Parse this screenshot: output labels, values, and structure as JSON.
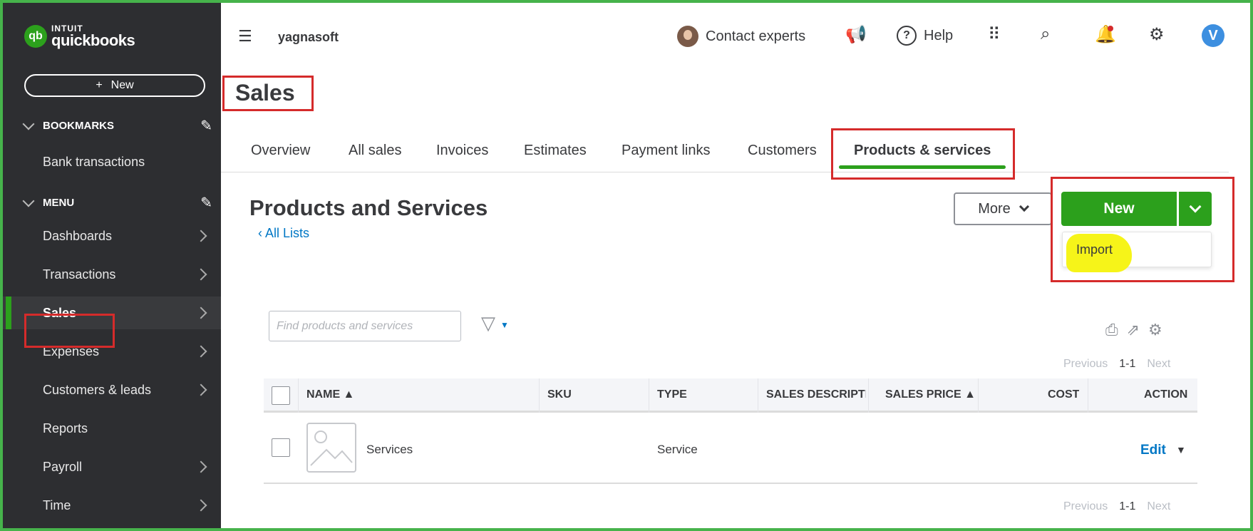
{
  "sidebar": {
    "logo_intuit": "INTUIT",
    "logo_name": "quickbooks",
    "new_label": "New",
    "bookmarks_label": "BOOKMARKS",
    "bookmark_items": [
      "Bank transactions"
    ],
    "menu_label": "MENU",
    "menu_items": [
      {
        "label": "Dashboards"
      },
      {
        "label": "Transactions"
      },
      {
        "label": "Sales",
        "active": true
      },
      {
        "label": "Expenses"
      },
      {
        "label": "Customers & leads"
      },
      {
        "label": "Reports"
      },
      {
        "label": "Payroll"
      },
      {
        "label": "Time"
      }
    ]
  },
  "topbar": {
    "company": "yagnasoft",
    "contact_label": "Contact experts",
    "help_label": "Help",
    "user_initial": "V"
  },
  "page": {
    "title": "Sales",
    "tabs": [
      "Overview",
      "All sales",
      "Invoices",
      "Estimates",
      "Payment links",
      "Customers",
      "Products & services"
    ],
    "active_tab": "Products & services"
  },
  "products": {
    "heading": "Products and Services",
    "back_link": "All Lists",
    "more_label": "More",
    "new_label": "New",
    "dropdown_items": [
      "Import"
    ],
    "search_placeholder": "Find products and services",
    "pager": {
      "previous": "Previous",
      "range": "1-1",
      "next": "Next"
    },
    "columns": [
      "NAME ▲",
      "SKU",
      "TYPE",
      "SALES DESCRIPTION",
      "SALES PRICE ▲",
      "COST",
      "ACTION"
    ],
    "rows": [
      {
        "name": "Services",
        "sku": "",
        "type": "Service",
        "description": "",
        "price": "",
        "cost": "",
        "action": "Edit"
      }
    ]
  },
  "colors": {
    "accent_green": "#2ca01c",
    "link_blue": "#0077c5",
    "annotation_red": "#d52b2b",
    "highlight_yellow": "#f6f419",
    "sidebar_bg": "#2d2e31"
  }
}
